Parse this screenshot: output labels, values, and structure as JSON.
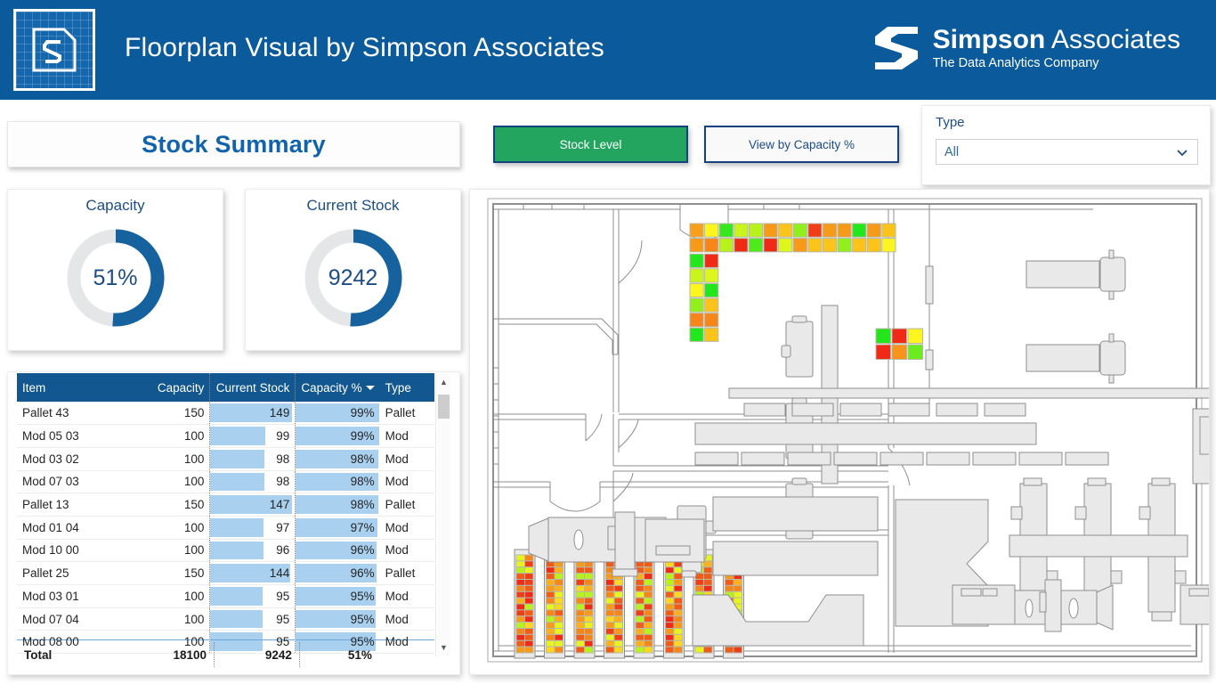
{
  "header": {
    "title": "Floorplan Visual by Simpson Associates",
    "brand_name_bold": "Simpson",
    "brand_name_light": " Associates",
    "brand_tagline": "The Data Analytics Company",
    "bg_color": "#0a5a9c"
  },
  "summary": {
    "title": "Stock Summary"
  },
  "toggles": {
    "stock_level": "Stock Level",
    "view_by_capacity": "View by Capacity %",
    "active_color": "#23a45f",
    "inactive_color": "#f9f9f9"
  },
  "slicer": {
    "label": "Type",
    "selected": "All"
  },
  "gauges": [
    {
      "title": "Capacity",
      "value": "51%",
      "percent": 51,
      "arc_color": "#15629f",
      "track_color": "#e4e6e8"
    },
    {
      "title": "Current Stock",
      "value": "9242",
      "percent": 51,
      "arc_color": "#15629f",
      "track_color": "#e4e6e8"
    }
  ],
  "table": {
    "columns": [
      "Item",
      "Capacity",
      "Current Stock",
      "Capacity %",
      "Type"
    ],
    "sorted_column": "Capacity %",
    "rows": [
      {
        "item": "Pallet 43",
        "capacity": "150",
        "current": "149",
        "pct": "99%",
        "type": "Pallet",
        "cur_bar": 97,
        "pct_bar": 99
      },
      {
        "item": "Mod 05 03",
        "capacity": "100",
        "current": "99",
        "pct": "99%",
        "type": "Mod",
        "cur_bar": 65,
        "pct_bar": 99
      },
      {
        "item": "Mod 03 02",
        "capacity": "100",
        "current": "98",
        "pct": "98%",
        "type": "Mod",
        "cur_bar": 64,
        "pct_bar": 98
      },
      {
        "item": "Mod 07 03",
        "capacity": "100",
        "current": "98",
        "pct": "98%",
        "type": "Mod",
        "cur_bar": 64,
        "pct_bar": 98
      },
      {
        "item": "Pallet 13",
        "capacity": "150",
        "current": "147",
        "pct": "98%",
        "type": "Pallet",
        "cur_bar": 96,
        "pct_bar": 98
      },
      {
        "item": "Mod 01 04",
        "capacity": "100",
        "current": "97",
        "pct": "97%",
        "type": "Mod",
        "cur_bar": 63,
        "pct_bar": 97
      },
      {
        "item": "Mod 10 00",
        "capacity": "100",
        "current": "96",
        "pct": "96%",
        "type": "Mod",
        "cur_bar": 63,
        "pct_bar": 96
      },
      {
        "item": "Pallet 25",
        "capacity": "150",
        "current": "144",
        "pct": "96%",
        "type": "Pallet",
        "cur_bar": 94,
        "pct_bar": 96
      },
      {
        "item": "Mod 03 01",
        "capacity": "100",
        "current": "95",
        "pct": "95%",
        "type": "Mod",
        "cur_bar": 62,
        "pct_bar": 95
      },
      {
        "item": "Mod 07 04",
        "capacity": "100",
        "current": "95",
        "pct": "95%",
        "type": "Mod",
        "cur_bar": 62,
        "pct_bar": 95
      },
      {
        "item": "Mod 08 00",
        "capacity": "100",
        "current": "95",
        "pct": "95%",
        "type": "Mod",
        "cur_bar": 62,
        "pct_bar": 95
      }
    ],
    "total": {
      "label": "Total",
      "capacity": "18100",
      "current": "9242",
      "pct": "51%",
      "type": ""
    }
  },
  "floorplan": {
    "pallet_rows_top": [
      [
        "#f7a11a",
        "#fdf61e",
        "#35e81d",
        "#c9f41c",
        "#b8f21c",
        "#f79a1a",
        "#fcc41b",
        "#91ef1d",
        "#ef3d17",
        "#f79a1a",
        "#f79a1a",
        "#23e61d",
        "#f79a1a",
        "#fcc41b"
      ],
      [
        "#f79a1a",
        "#f7861a",
        "#b8f21c",
        "#ef2a17",
        "#4eea1d",
        "#ef2a17",
        "#ddf71d",
        "#f79a1a",
        "#fcc41b",
        "#fcc41b",
        "#91ef1d",
        "#fcc41b",
        "#fcc41b",
        "#fdf61e"
      ]
    ],
    "pallet_col_left": [
      [
        "#23e61d",
        "#ef2a17"
      ],
      [
        "#c9f41c",
        "#ddf71d"
      ],
      [
        "#fdf61e",
        "#23e61d"
      ],
      [
        "#91ef1d",
        "#fcc41b"
      ],
      [
        "#f7861a",
        "#f7861a"
      ],
      [
        "#23e61d",
        "#fcc41b"
      ]
    ],
    "pallet_block_mid": [
      [
        "#23e61d",
        "#ef2a17",
        "#fdf61e"
      ],
      [
        "#ef2a17",
        "#f7951a",
        "#6aec1d"
      ]
    ],
    "rack_strip_count": 8,
    "rack_cells_per_strip": 16,
    "rack_palette": [
      "#ef2a17",
      "#f25a17",
      "#f7861a",
      "#fcb01b",
      "#fdd81e",
      "#e8f41d",
      "#b8f21c",
      "#f79a1a",
      "#f25a17",
      "#ef3d17"
    ]
  }
}
